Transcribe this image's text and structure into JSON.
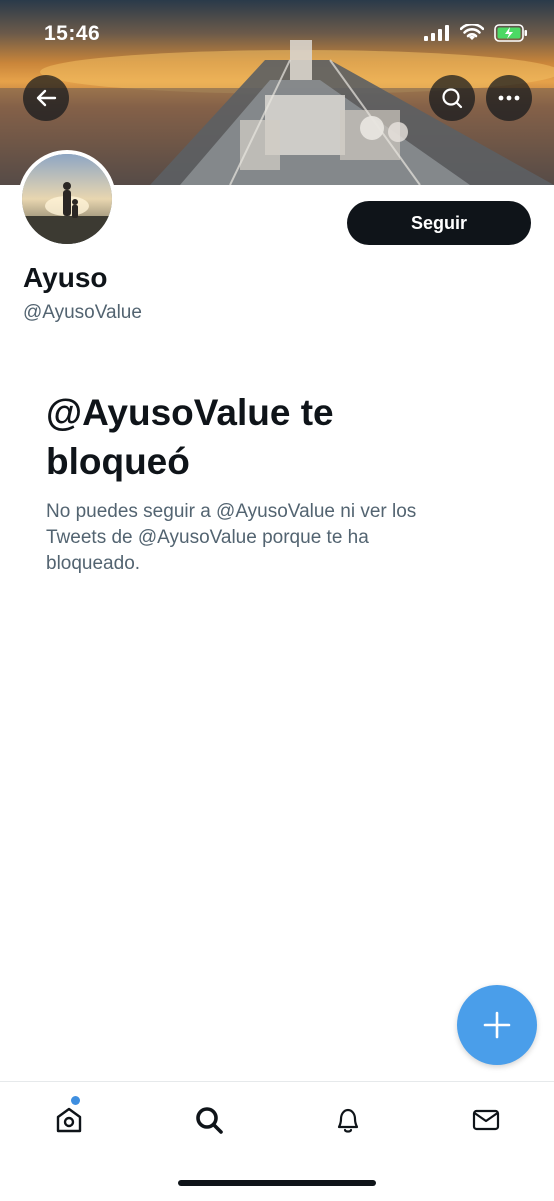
{
  "status_bar": {
    "time": "15:46"
  },
  "profile": {
    "display_name": "Ayuso",
    "handle": "@AyusoValue",
    "follow_label": "Seguir"
  },
  "blocked": {
    "title": "@AyusoValue te bloqueó",
    "description": "No puedes seguir a @AyusoValue ni ver los Tweets de @AyusoValue porque te ha bloqueado."
  },
  "icons": {
    "back": "arrow-left-icon",
    "search": "search-icon",
    "more": "more-horizontal-icon",
    "compose": "plus-icon",
    "tabs": [
      "home-icon",
      "search-icon",
      "bell-icon",
      "mail-icon"
    ]
  },
  "colors": {
    "accent": "#4a9eea",
    "button_dark": "#0f1419",
    "secondary_text": "#536471",
    "notification_dot": "#3f8fe0"
  },
  "tabs": {
    "home_has_notification": true
  }
}
